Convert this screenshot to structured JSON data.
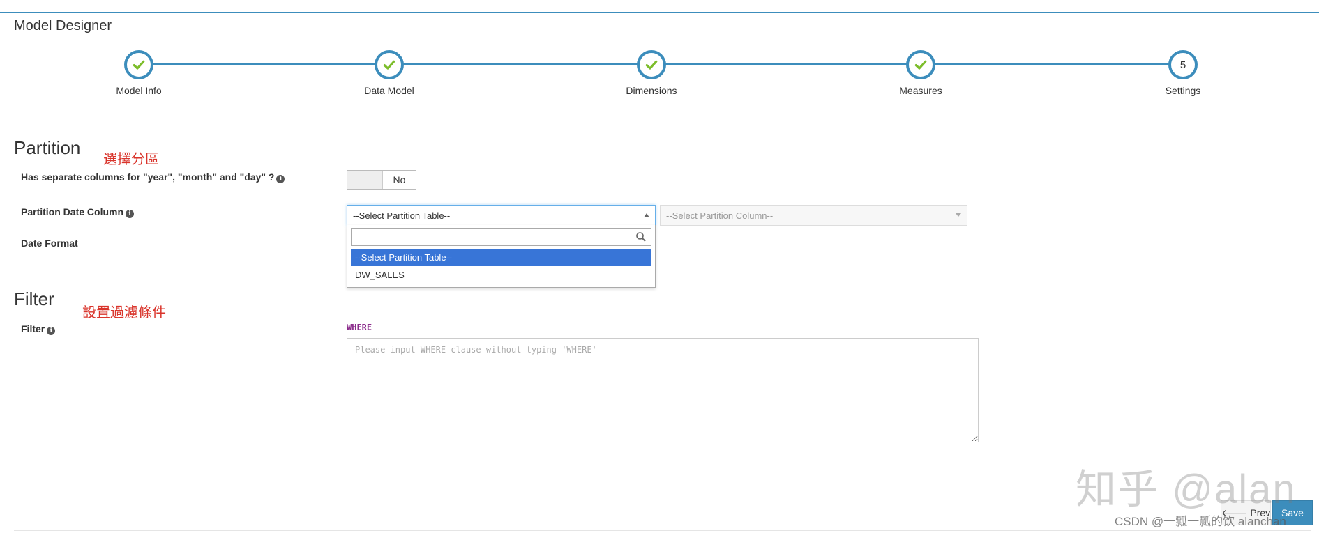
{
  "header": {
    "title": "Model Designer"
  },
  "wizard": {
    "steps": [
      {
        "label": "Model Info",
        "state": "done"
      },
      {
        "label": "Data Model",
        "state": "done"
      },
      {
        "label": "Dimensions",
        "state": "done"
      },
      {
        "label": "Measures",
        "state": "done"
      },
      {
        "label": "Settings",
        "state": "current",
        "number": "5"
      }
    ]
  },
  "partition": {
    "title": "Partition",
    "annotation": "選擇分區",
    "separate_columns_label": "Has separate columns for \"year\", \"month\" and \"day\" ?",
    "toggle_value": "No",
    "date_column_label": "Partition Date Column",
    "table_select": {
      "value": "--Select Partition Table--",
      "options": [
        "--Select Partition Table--",
        "DW_SALES"
      ]
    },
    "column_select": {
      "value": "--Select Partition Column--"
    },
    "date_format_label": "Date Format"
  },
  "filter": {
    "title": "Filter",
    "annotation": "設置過濾條件",
    "label": "Filter",
    "keyword": "WHERE",
    "placeholder": "Please input WHERE clause without typing 'WHERE'"
  },
  "footer": {
    "prev_label": "Prev",
    "save_label": "Save"
  },
  "watermarks": {
    "zhihu": "知乎 @alan",
    "csdn": "CSDN @一瓢一瓢的饮 alanchan"
  },
  "colors": {
    "accent": "#3c8dbc",
    "check": "#7cbd2a",
    "annotation": "#d9342b",
    "highlight": "#3875d7"
  }
}
